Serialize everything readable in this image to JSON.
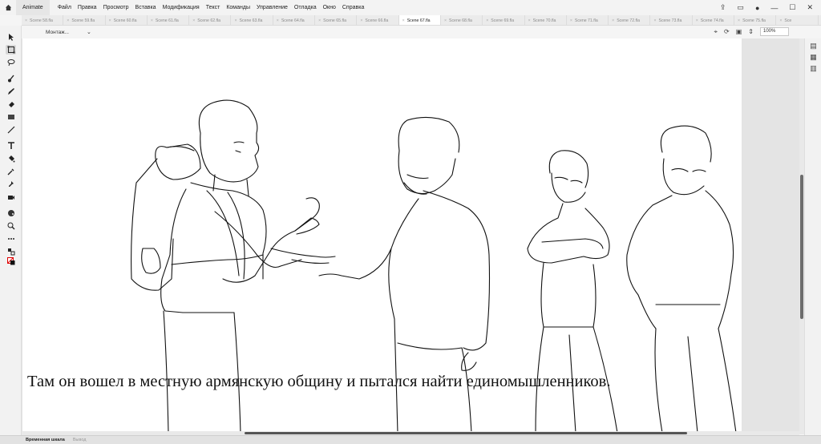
{
  "menubar": {
    "app_name": "Animate",
    "menus": [
      "Файл",
      "Правка",
      "Просмотр",
      "Вставка",
      "Модификация",
      "Текст",
      "Команды",
      "Управление",
      "Отладка",
      "Окно",
      "Справка"
    ],
    "right_icons": [
      "share-icon",
      "window-icon",
      "play-icon",
      "minimize-icon",
      "maximize-icon",
      "close-icon"
    ]
  },
  "tabs": [
    {
      "label": "Scene 58.fla",
      "active": false
    },
    {
      "label": "Scene 59.fla",
      "active": false
    },
    {
      "label": "Scene 60.fla",
      "active": false
    },
    {
      "label": "Scene 61.fla",
      "active": false
    },
    {
      "label": "Scene 62.fla",
      "active": false
    },
    {
      "label": "Scene 63.fla",
      "active": false
    },
    {
      "label": "Scene 64.fla",
      "active": false
    },
    {
      "label": "Scene 65.fla",
      "active": false
    },
    {
      "label": "Scene 66.fla",
      "active": false
    },
    {
      "label": "Scene 67.fla",
      "active": true
    },
    {
      "label": "Scene 68.fla",
      "active": false
    },
    {
      "label": "Scene 69.fla",
      "active": false
    },
    {
      "label": "Scene 70.fla",
      "active": false
    },
    {
      "label": "Scene 71.fla",
      "active": false
    },
    {
      "label": "Scene 72.fla",
      "active": false
    },
    {
      "label": "Scene 73.fla",
      "active": false
    },
    {
      "label": "Scene 74.fla",
      "active": false
    },
    {
      "label": "Scene 75.fla",
      "active": false
    },
    {
      "label": "Sce",
      "active": false
    }
  ],
  "editbar": {
    "scene_name": "Монтаж...",
    "zoom": "100%"
  },
  "stage": {
    "caption": "Там он вошел в местную армянскую общину и пытался найти единомышленников."
  },
  "bottombar": {
    "timeline_label": "Временная шкала",
    "output_label": "Вывод"
  }
}
